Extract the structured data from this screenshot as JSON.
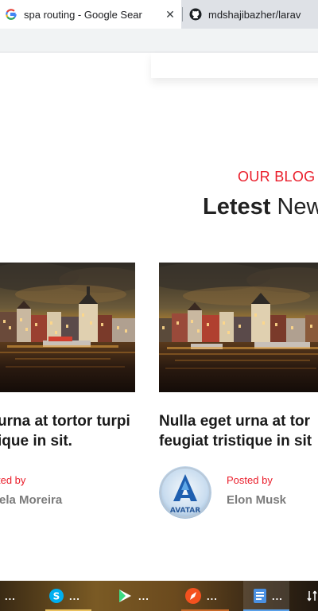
{
  "browser": {
    "tabs": [
      {
        "title": "spa routing - Google Sear",
        "favicon": "google-icon",
        "close": "✕",
        "active": true
      },
      {
        "title": "mdshajibazher/larav",
        "favicon": "github-icon",
        "active": false
      }
    ]
  },
  "blog": {
    "eyebrow": "OUR BLOG",
    "title_bold": "Letest",
    "title_rest": " New",
    "posts": [
      {
        "title_line1": "urna at tortor turpi",
        "title_line2": "ique in sit.",
        "posted_label": "ted by",
        "author": "ela Moreira"
      },
      {
        "title_line1": "Nulla eget urna at tor",
        "title_line2": "feugiat tristique in sit",
        "posted_label": "Posted by",
        "author": "Elon Musk",
        "avatar_text": "AVATAR"
      }
    ]
  },
  "taskbar": {
    "items": [
      {
        "icon": "app-icon",
        "label": "..."
      },
      {
        "icon": "skype-icon",
        "label": "..."
      },
      {
        "icon": "play-icon",
        "label": "..."
      },
      {
        "icon": "browser-icon",
        "label": "..."
      },
      {
        "icon": "document-icon",
        "label": "..."
      }
    ],
    "tray_icon": "network-icon",
    "colors": {
      "skype": "#00aff0",
      "play": "#3ddc84",
      "browser": "#f4511e",
      "document": "#4a90e2"
    }
  },
  "colors": {
    "accent": "#ea1d2a",
    "heading": "#222222",
    "author": "#7b7b7b"
  }
}
